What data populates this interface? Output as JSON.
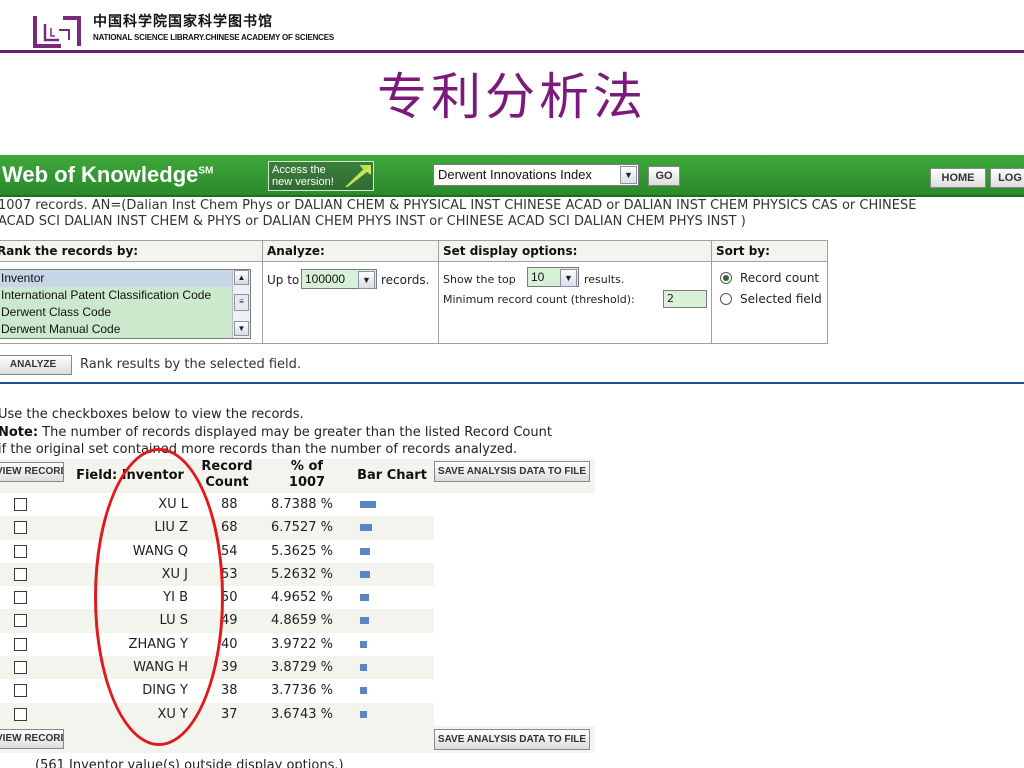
{
  "header": {
    "org_cn": "中国科学院国家科学图书馆",
    "org_en": "NATIONAL SCIENCE LIBRARY.CHINESE ACADEMY OF SCIENCES",
    "logo_text": "L LT",
    "slide_title": "专利分析法",
    "accent_color": "#6b1f6e"
  },
  "wok": {
    "brand": "Web of Knowledge",
    "brand_mark": "SM",
    "access_line1": "Access the",
    "access_line2": "new version!",
    "database": "Derwent Innovations Index",
    "go_label": "GO",
    "home_label": "HOME",
    "log_label": "LOG",
    "bar_color": "#3fa83b"
  },
  "query": {
    "line1": "1007 records. AN=(Dalian Inst Chem Phys or DALIAN CHEM & PHYSICAL INST CHINESE ACAD or DALIAN INST CHEM PHYSICS CAS or CHINESE",
    "line2": "ACAD SCI DALIAN INST CHEM & PHYS or DALIAN CHEM PHYS INST or CHINESE ACAD SCI DALIAN CHEM PHYS INST )"
  },
  "panels": {
    "rank_header": "Rank the records by:",
    "rank_options": [
      "Inventor",
      "International Patent Classification Code",
      "Derwent Class Code",
      "Derwent Manual Code"
    ],
    "analyze_header": "Analyze:",
    "analyze_prefix": "Up to",
    "analyze_value": "100000",
    "analyze_suffix": "records.",
    "display_header": "Set display options:",
    "display_prefix": "Show the top",
    "display_value": "10",
    "display_suffix": "results.",
    "threshold_label": "Minimum record count (threshold):",
    "threshold_value": "2",
    "sort_header": "Sort by:",
    "sort_record_count": "Record count",
    "sort_selected_field": "Selected field"
  },
  "analyze_button": "ANALYZE",
  "analyze_hint": "Rank results by the selected field.",
  "notes": {
    "line1": "Use the checkboxes below to view the records.",
    "note_label": "Note:",
    "line2": " The number of records displayed may be greater than the listed Record Count",
    "line3": "if the original set contained more records than the number of records analyzed."
  },
  "results": {
    "view_records": "VIEW RECORDS",
    "field_header": "Field: Inventor",
    "record_header_1": "Record",
    "record_header_2": "Count",
    "pct_header_1": "% of",
    "pct_header_2": "1007",
    "bar_header": "Bar Chart",
    "save_label": "SAVE ANALYSIS DATA TO FILE",
    "bar_color": "#5b86c4",
    "rows": [
      {
        "inventor": "XU L",
        "count": "88",
        "percent": "8.7388 %"
      },
      {
        "inventor": "LIU Z",
        "count": "68",
        "percent": "6.7527 %"
      },
      {
        "inventor": "WANG Q",
        "count": "54",
        "percent": "5.3625 %"
      },
      {
        "inventor": "XU J",
        "count": "53",
        "percent": "5.2632 %"
      },
      {
        "inventor": "YI B",
        "count": "50",
        "percent": "4.9652 %"
      },
      {
        "inventor": "LU S",
        "count": "49",
        "percent": "4.8659 %"
      },
      {
        "inventor": "ZHANG Y",
        "count": "40",
        "percent": "3.9722 %"
      },
      {
        "inventor": "WANG H",
        "count": "39",
        "percent": "3.8729 %"
      },
      {
        "inventor": "DING Y",
        "count": "38",
        "percent": "3.7736 %"
      },
      {
        "inventor": "XU Y",
        "count": "37",
        "percent": "3.6743 %"
      }
    ],
    "outside_note": "(561 Inventor value(s) outside display options.)"
  },
  "annotation_color": "#e0191c"
}
